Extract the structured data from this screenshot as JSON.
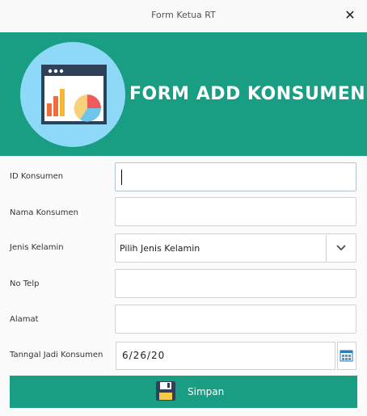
{
  "window": {
    "title": "Form Ketua RT",
    "close_glyph": "✕"
  },
  "header": {
    "logo_icon": "dashboard-chart-icon",
    "title": "FORM ADD KONSUMEN",
    "background_color": "#1a9e83",
    "logo_circle_color": "#8fd9f8"
  },
  "form": {
    "id_konsumen": {
      "label": "ID Konsumen",
      "value": ""
    },
    "nama_konsumen": {
      "label": "Nama Konsumen",
      "value": ""
    },
    "jenis_kelamin": {
      "label": "Jenis Kelamin",
      "selected": "Pilih Jenis Kelamin"
    },
    "no_telp": {
      "label": "No Telp",
      "value": ""
    },
    "alamat": {
      "label": "Alamat",
      "value": ""
    },
    "tanggal_jadi": {
      "label": "Tanngal Jadi Konsumen",
      "value": "6/26/20",
      "calendar_icon": "calendar-icon"
    }
  },
  "actions": {
    "save_label": "Simpan",
    "save_icon": "floppy-disk-icon"
  }
}
